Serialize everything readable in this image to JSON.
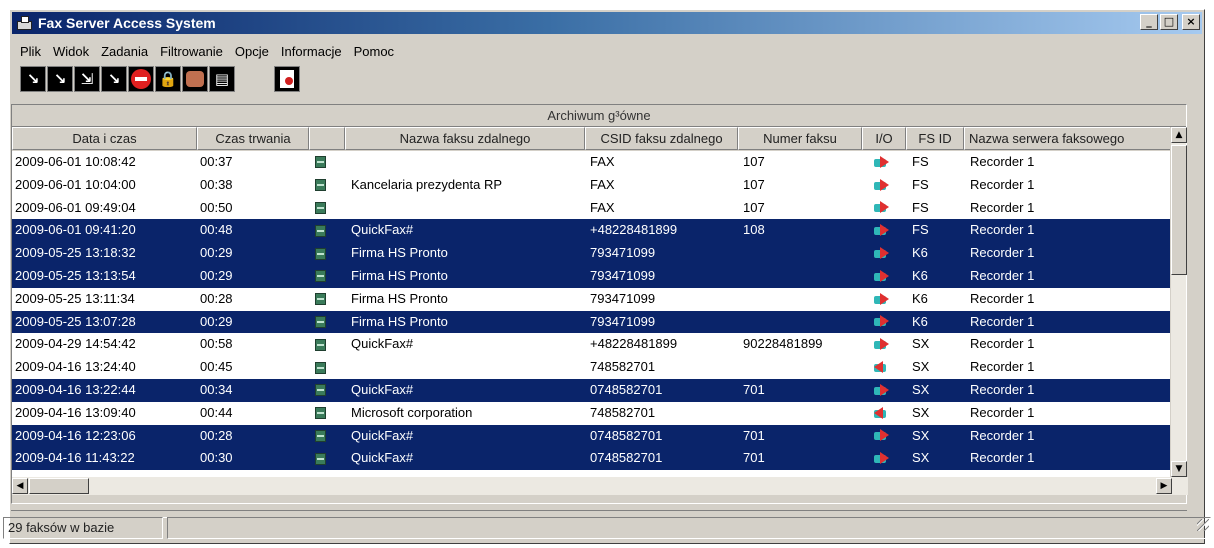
{
  "window": {
    "title": "Fax Server Access System",
    "minimize": "_",
    "maximize": "□",
    "close": "×"
  },
  "menu": [
    "Plik",
    "Widok",
    "Zadania",
    "Filtrowanie",
    "Opcje",
    "Informacje",
    "Pomoc"
  ],
  "toolbar_icons": [
    "filter-all-icon",
    "arrow-down-right-icon",
    "arrow-down-right-alt-icon",
    "arrow-down-right-outline-icon",
    "stop-icon",
    "lock-icon",
    "fax-machine-icon",
    "card-icon",
    "document-search-icon"
  ],
  "grid": {
    "title": "Archiwum g³ówne",
    "columns": [
      "Data i czas",
      "Czas trwania",
      "",
      "Nazwa faksu zdalnego",
      "CSID faksu zdalnego",
      "Numer faksu",
      "I/O",
      "FS ID",
      "Nazwa serwera faksowego"
    ],
    "rows": [
      {
        "date": "2009-06-01 10:08:42",
        "duration": "00:37",
        "name": "",
        "csid": "FAX",
        "number": "107",
        "io": "out",
        "fsid": "FS",
        "server": "Recorder 1",
        "selected": false
      },
      {
        "date": "2009-06-01 10:04:00",
        "duration": "00:38",
        "name": "Kancelaria prezydenta RP",
        "csid": "FAX",
        "number": "107",
        "io": "out",
        "fsid": "FS",
        "server": "Recorder 1",
        "selected": false
      },
      {
        "date": "2009-06-01 09:49:04",
        "duration": "00:50",
        "name": "",
        "csid": "FAX",
        "number": "107",
        "io": "out",
        "fsid": "FS",
        "server": "Recorder 1",
        "selected": false
      },
      {
        "date": "2009-06-01 09:41:20",
        "duration": "00:48",
        "name": "QuickFax#",
        "csid": "+48228481899",
        "number": "108",
        "io": "out",
        "fsid": "FS",
        "server": "Recorder 1",
        "selected": true
      },
      {
        "date": "2009-05-25 13:18:32",
        "duration": "00:29",
        "name": "Firma HS Pronto",
        "csid": "793471099",
        "number": "",
        "io": "out",
        "fsid": "K6",
        "server": "Recorder 1",
        "selected": true
      },
      {
        "date": "2009-05-25 13:13:54",
        "duration": "00:29",
        "name": "Firma HS Pronto",
        "csid": "793471099",
        "number": "",
        "io": "out",
        "fsid": "K6",
        "server": "Recorder 1",
        "selected": true
      },
      {
        "date": "2009-05-25 13:11:34",
        "duration": "00:28",
        "name": "Firma HS Pronto",
        "csid": "793471099",
        "number": "",
        "io": "out",
        "fsid": "K6",
        "server": "Recorder 1",
        "selected": false
      },
      {
        "date": "2009-05-25 13:07:28",
        "duration": "00:29",
        "name": "Firma HS Pronto",
        "csid": "793471099",
        "number": "",
        "io": "out",
        "fsid": "K6",
        "server": "Recorder 1",
        "selected": true
      },
      {
        "date": "2009-04-29 14:54:42",
        "duration": "00:58",
        "name": "QuickFax#",
        "csid": "+48228481899",
        "number": "90228481899",
        "io": "out",
        "fsid": "SX",
        "server": "Recorder 1",
        "selected": false
      },
      {
        "date": "2009-04-16 13:24:40",
        "duration": "00:45",
        "name": "",
        "csid": "748582701",
        "number": "",
        "io": "in",
        "fsid": "SX",
        "server": "Recorder 1",
        "selected": false
      },
      {
        "date": "2009-04-16 13:22:44",
        "duration": "00:34",
        "name": "QuickFax#",
        "csid": "0748582701",
        "number": "701",
        "io": "out",
        "fsid": "SX",
        "server": "Recorder 1",
        "selected": true
      },
      {
        "date": "2009-04-16 13:09:40",
        "duration": "00:44",
        "name": "Microsoft corporation",
        "csid": "748582701",
        "number": "",
        "io": "in",
        "fsid": "SX",
        "server": "Recorder 1",
        "selected": false
      },
      {
        "date": "2009-04-16 12:23:06",
        "duration": "00:28",
        "name": "QuickFax#",
        "csid": "0748582701",
        "number": "701",
        "io": "out",
        "fsid": "SX",
        "server": "Recorder 1",
        "selected": true
      },
      {
        "date": "2009-04-16 11:43:22",
        "duration": "00:30",
        "name": "QuickFax#",
        "csid": "0748582701",
        "number": "701",
        "io": "out",
        "fsid": "SX",
        "server": "Recorder 1",
        "selected": true
      }
    ]
  },
  "status": {
    "count_text": "29 faksów w bazie"
  },
  "colors": {
    "selection": "#0a246a",
    "title_gradient_start": "#0a246a",
    "title_gradient_end": "#a6caf0",
    "chrome": "#d4d0c8"
  }
}
